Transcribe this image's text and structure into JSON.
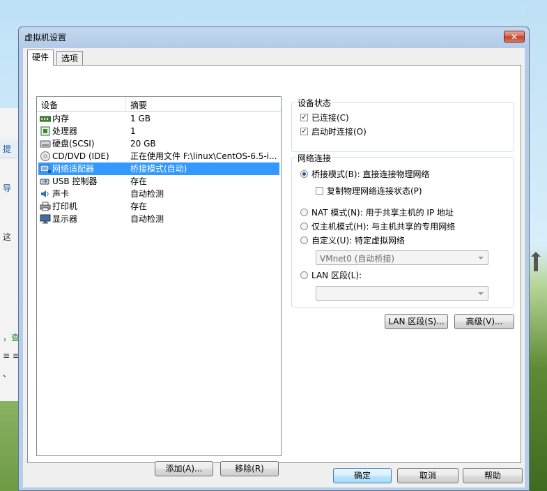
{
  "dialog": {
    "title": "虚拟机设置",
    "close": "✕"
  },
  "tabs": [
    {
      "label": "硬件"
    },
    {
      "label": "选项"
    }
  ],
  "device_list": {
    "headers": {
      "device": "设备",
      "summary": "摘要"
    },
    "rows": [
      {
        "name": "内存",
        "summary": "1 GB",
        "icon": "memory-icon"
      },
      {
        "name": "处理器",
        "summary": "1",
        "icon": "processor-icon"
      },
      {
        "name": "硬盘(SCSI)",
        "summary": "20 GB",
        "icon": "harddisk-icon"
      },
      {
        "name": "CD/DVD (IDE)",
        "summary": "正在使用文件 F:\\linux\\CentOS-6.5-i...",
        "icon": "cdrom-icon"
      },
      {
        "name": "网络适配器",
        "summary": "桥接模式(自动)",
        "icon": "network-adapter-icon",
        "selected": true
      },
      {
        "name": "USB 控制器",
        "summary": "存在",
        "icon": "usb-icon"
      },
      {
        "name": "声卡",
        "summary": "自动检测",
        "icon": "sound-icon"
      },
      {
        "name": "打印机",
        "summary": "存在",
        "icon": "printer-icon"
      },
      {
        "name": "显示器",
        "summary": "自动检测",
        "icon": "display-icon"
      }
    ],
    "add_button": "添加(A)...",
    "remove_button": "移除(R)"
  },
  "device_status": {
    "title": "设备状态",
    "connected": {
      "label": "已连接(C)",
      "checked": true
    },
    "connect_at_power_on": {
      "label": "启动时连接(O)",
      "checked": true
    }
  },
  "network": {
    "title": "网络连接",
    "bridged": {
      "label": "桥接模式(B): 直接连接物理网络",
      "selected": true
    },
    "replicate": {
      "label": "复制物理网络连接状态(P)",
      "checked": false
    },
    "nat": {
      "label": "NAT 模式(N): 用于共享主机的 IP 地址"
    },
    "host_only": {
      "label": "仅主机模式(H): 与主机共享的专用网络"
    },
    "custom": {
      "label": "自定义(U): 特定虚拟网络",
      "value": "VMnet0 (自动桥接)"
    },
    "lan_segment": {
      "label": "LAN 区段(L):",
      "value": ""
    }
  },
  "right_buttons": {
    "lan_segments": "LAN 区段(S)...",
    "advanced": "高级(V)..."
  },
  "footer": {
    "ok": "确定",
    "cancel": "取消",
    "help": "帮助"
  },
  "background_window": {
    "t1": "提",
    "t2": "导",
    "t3": "这",
    "t4": "，查",
    "t5": "≡ ≡",
    "t6": "、"
  },
  "colors": {
    "selection": "#3399ff",
    "title_bar": "#c4d7ee",
    "close": "#c2402a"
  }
}
